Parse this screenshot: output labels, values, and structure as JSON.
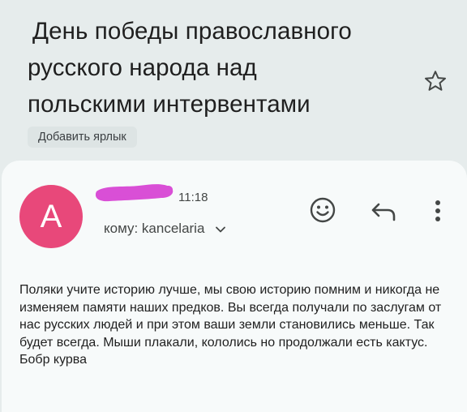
{
  "email": {
    "subject": "День победы православного\nрусского народа над\nпольскими интервентами",
    "label_chip": "Добавить ярлык",
    "avatar_letter": "A",
    "time": "11:18",
    "recipient_prefix": "кому:",
    "recipient_name": "kancelaria",
    "body": "Поляки учите историю лучше, мы свою историю помним и никогда не изменяем памяти наших предков. Вы всегда получали по заслугам от нас русских людей и при этом ваши земли становились меньше. Так будет всегда. Мыши плакали, кололись но продолжали есть кактус. Бобр курва"
  },
  "icons": {
    "star": "star-outline-icon",
    "emoji": "add-emoji-icon",
    "reply": "reply-icon",
    "more": "more-vert-icon",
    "chevron": "chevron-down-icon"
  },
  "colors": {
    "background": "#e6ecec",
    "card": "#f7fafa",
    "avatar": "#e8487a",
    "redaction": "#d94fd6"
  }
}
